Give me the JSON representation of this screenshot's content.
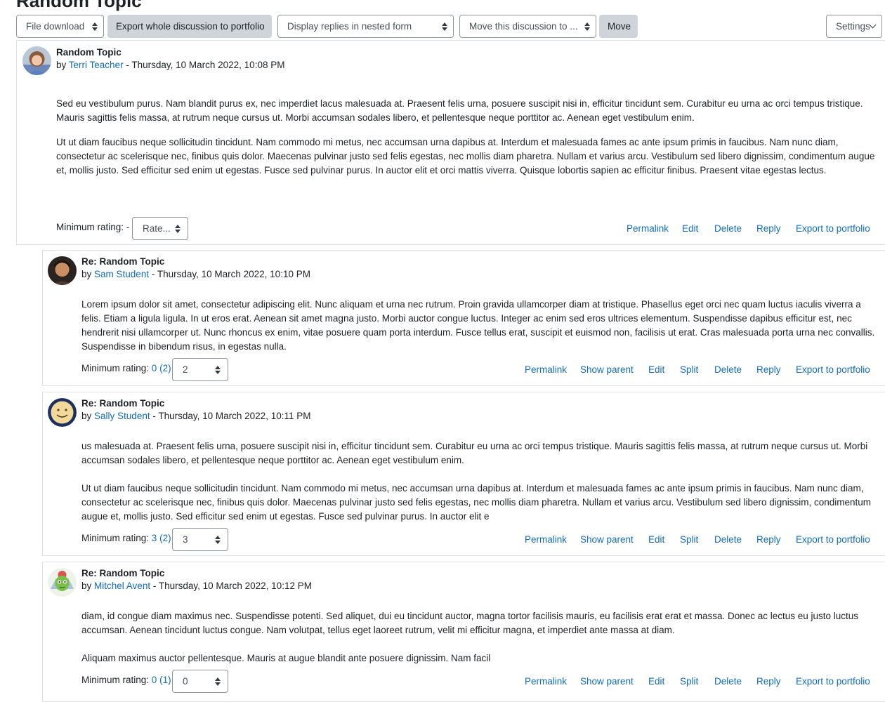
{
  "page": {
    "title": "Random Topic"
  },
  "toolbar": {
    "file_download": "File download",
    "export_whole": "Export whole discussion to portfolio",
    "display_mode": "Display replies in nested form",
    "move_select": "Move this discussion to ...",
    "move_button": "Move",
    "settings": "Settings"
  },
  "posts": [
    {
      "subject": "Random Topic",
      "by_prefix": "by",
      "author": "Terri Teacher",
      "date": "- Thursday, 10 March 2022, 10:08 PM",
      "paragraphs": [
        "Sed eu vestibulum purus. Nam blandit purus ex, nec imperdiet lacus malesuada at. Praesent felis urna, posuere suscipit nisi in, efficitur tincidunt sem. Curabitur eu urna ac orci tempus tristique. Mauris sagittis felis massa, at rutrum neque cursus ut. Morbi accumsan sodales libero, et pellentesque neque porttitor ac. Aenean eget vestibulum enim.",
        "Ut ut diam faucibus neque sollicitudin tincidunt. Nam commodo mi metus, nec accumsan urna dapibus at. Interdum et malesuada fames ac ante ipsum primis in faucibus. Nam nunc diam, consectetur ac scelerisque nec, finibus quis dolor. Maecenas pulvinar justo sed felis egestas, nec mollis diam pharetra. Nullam et varius arcu. Vestibulum sed libero dignissim, condimentum augue et, mollis justo. Sed efficitur sed enim ut egestas. Fusce sed pulvinar purus. In auctor elit et orci mattis viverra. Quisque lobortis sapien ac efficitur finibus. Praesent vitae egestas lectus."
      ],
      "rating_label": "Minimum rating:",
      "rating_value": "-",
      "rating_count": "",
      "rate_select": "Rate...",
      "actions": [
        "Permalink",
        "Edit",
        "Delete",
        "Reply",
        "Export to portfolio"
      ]
    },
    {
      "subject": "Re: Random Topic",
      "by_prefix": "by",
      "author": "Sam Student",
      "date": "- Thursday, 10 March 2022, 10:10 PM",
      "paragraphs": [
        "Lorem ipsum dolor sit amet, consectetur adipiscing elit. Nunc aliquam et urna nec rutrum. Proin gravida ullamcorper diam at tristique. Phasellus eget orci nec quam luctus iaculis viverra a felis. Etiam a ligula ligula. In ut eros erat. Aenean sit amet magna justo. Morbi auctor congue luctus. Integer ac enim sed eros ultrices elementum. Suspendisse dapibus efficitur est, nec hendrerit nisi ullamcorper ut. Nunc rhoncus ex enim, vitae posuere quam porta interdum. Fusce tellus erat, suscipit et euismod non, facilisis ut erat. Cras malesuada porta urna nec convallis. Suspendisse in bibendum risus, in egestas nulla."
      ],
      "rating_label": "Minimum rating:",
      "rating_value": "0",
      "rating_count": "(2)",
      "rate_select": "2",
      "actions": [
        "Permalink",
        "Show parent",
        "Edit",
        "Split",
        "Delete",
        "Reply",
        "Export to portfolio"
      ]
    },
    {
      "subject": "Re: Random Topic",
      "by_prefix": "by",
      "author": "Sally Student",
      "date": "- Thursday, 10 March 2022, 10:11 PM",
      "paragraphs": [
        "us malesuada at. Praesent felis urna, posuere suscipit nisi in, efficitur tincidunt sem. Curabitur eu urna ac orci tempus tristique. Mauris sagittis felis massa, at rutrum neque cursus ut. Morbi accumsan sodales libero, et pellentesque neque porttitor ac. Aenean eget vestibulum enim.",
        "Ut ut diam faucibus neque sollicitudin tincidunt. Nam commodo mi metus, nec accumsan urna dapibus at. Interdum et malesuada fames ac ante ipsum primis in faucibus. Nam nunc diam, consectetur ac scelerisque nec, finibus quis dolor. Maecenas pulvinar justo sed felis egestas, nec mollis diam pharetra. Nullam et varius arcu. Vestibulum sed libero dignissim, condimentum augue et, mollis justo. Sed efficitur sed enim ut egestas. Fusce sed pulvinar purus. In auctor elit e"
      ],
      "rating_label": "Minimum rating:",
      "rating_value": "3",
      "rating_count": "(2)",
      "rate_select": "3",
      "actions": [
        "Permalink",
        "Show parent",
        "Edit",
        "Split",
        "Delete",
        "Reply",
        "Export to portfolio"
      ]
    },
    {
      "subject": "Re: Random Topic",
      "by_prefix": "by",
      "author": "Mitchel Avent",
      "date": "- Thursday, 10 March 2022, 10:12 PM",
      "paragraphs": [
        "diam, id congue diam maximus nec. Suspendisse potenti. Sed aliquet, dui eu tincidunt auctor, magna tortor facilisis mauris, eu facilisis erat erat et massa. Donec ac lectus eu justo luctus accumsan. Aenean tincidunt luctus congue. Nam volutpat, tellus eget laoreet rutrum, velit mi efficitur magna, et imperdiet ante massa at diam.",
        "Aliquam maximus auctor pellentesque. Mauris at augue blandit ante posuere dignissim. Nam facil"
      ],
      "rating_label": "Minimum rating:",
      "rating_value": "0",
      "rating_count": "(1)",
      "rate_select": "0",
      "actions": [
        "Permalink",
        "Show parent",
        "Edit",
        "Split",
        "Delete",
        "Reply",
        "Export to portfolio"
      ]
    }
  ]
}
